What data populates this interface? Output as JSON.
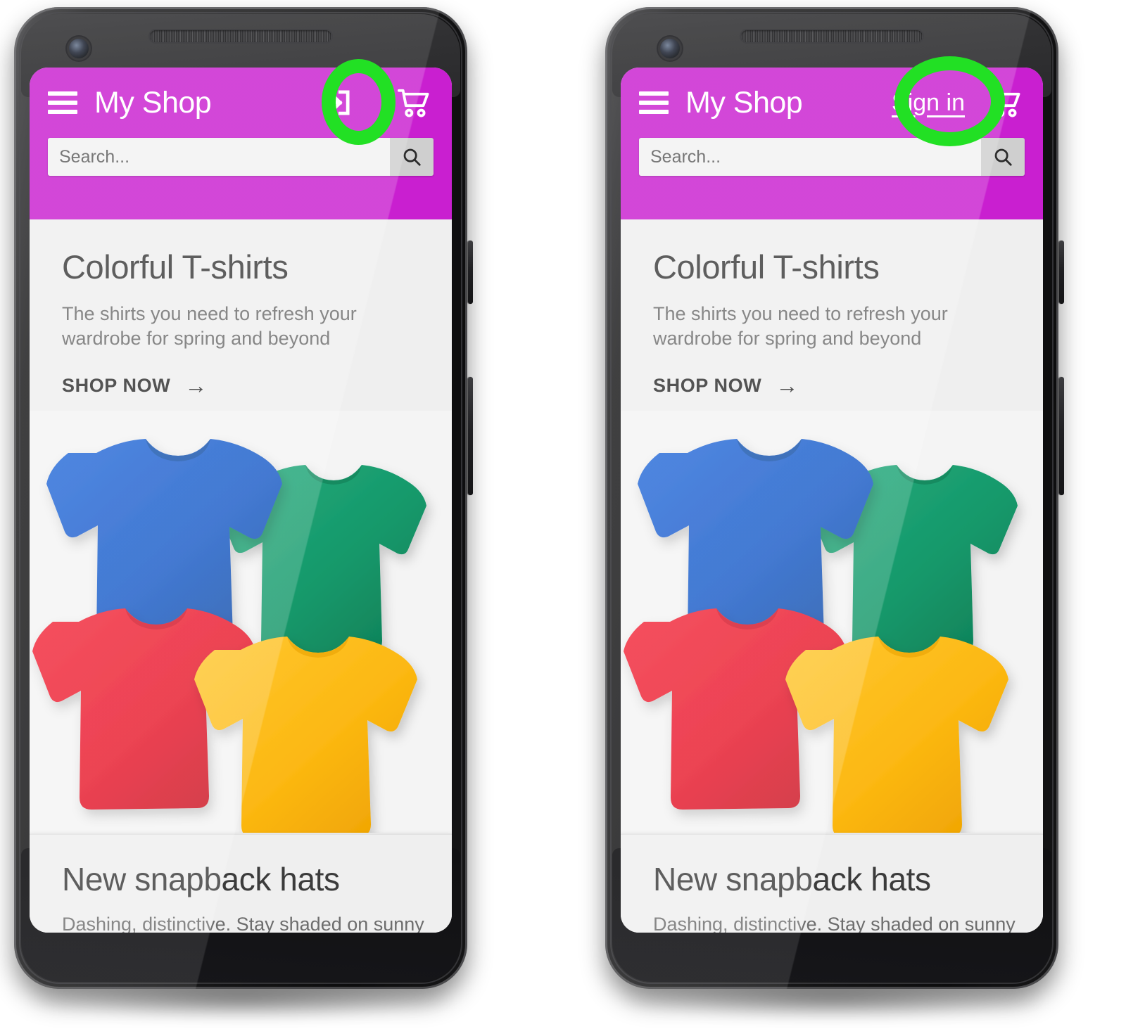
{
  "meta": {
    "accent_magenta": "#c91fd0",
    "highlight_green": "#22e024",
    "page_bg": "#efefef"
  },
  "phones": [
    {
      "id": "phone-before",
      "app_bar": {
        "menu_icon": "hamburger-menu-icon",
        "title": "My Shop",
        "auth_control": {
          "type": "icon",
          "icon": "login-icon",
          "label": ""
        },
        "cart_icon": "shopping-cart-icon"
      },
      "search": {
        "placeholder": "Search...",
        "value": "",
        "button_icon": "search-icon"
      },
      "hero": {
        "title": "Colorful T-shirts",
        "subtitle": "The shirts you need to refresh your wardrobe for spring and beyond",
        "cta_label": "SHOP NOW",
        "cta_arrow": "→",
        "image_alt": "four-folded-tshirts"
      },
      "next_card": {
        "title": "New snapback hats",
        "subtitle": "Dashing, distinctive. Stay shaded on sunny"
      },
      "annotation": {
        "shape": "ellipse",
        "target": "login-icon",
        "color": "#22e024"
      }
    },
    {
      "id": "phone-after",
      "app_bar": {
        "menu_icon": "hamburger-menu-icon",
        "title": "My Shop",
        "auth_control": {
          "type": "link",
          "icon": "",
          "label": "Sign in"
        },
        "cart_icon": "shopping-cart-icon"
      },
      "search": {
        "placeholder": "Search...",
        "value": "",
        "button_icon": "search-icon"
      },
      "hero": {
        "title": "Colorful T-shirts",
        "subtitle": "The shirts you need to refresh your wardrobe for spring and beyond",
        "cta_label": "SHOP NOW",
        "cta_arrow": "→",
        "image_alt": "four-folded-tshirts"
      },
      "next_card": {
        "title": "New snapback hats",
        "subtitle": "Dashing, distinctive. Stay shaded on sunny"
      },
      "annotation": {
        "shape": "circle",
        "target": "sign-in-link",
        "color": "#22e024"
      }
    }
  ],
  "shirt_colors": {
    "blue": "#1a5cc8",
    "green": "#16996b",
    "red": "#e81a2d",
    "yellow": "#fcb812"
  }
}
